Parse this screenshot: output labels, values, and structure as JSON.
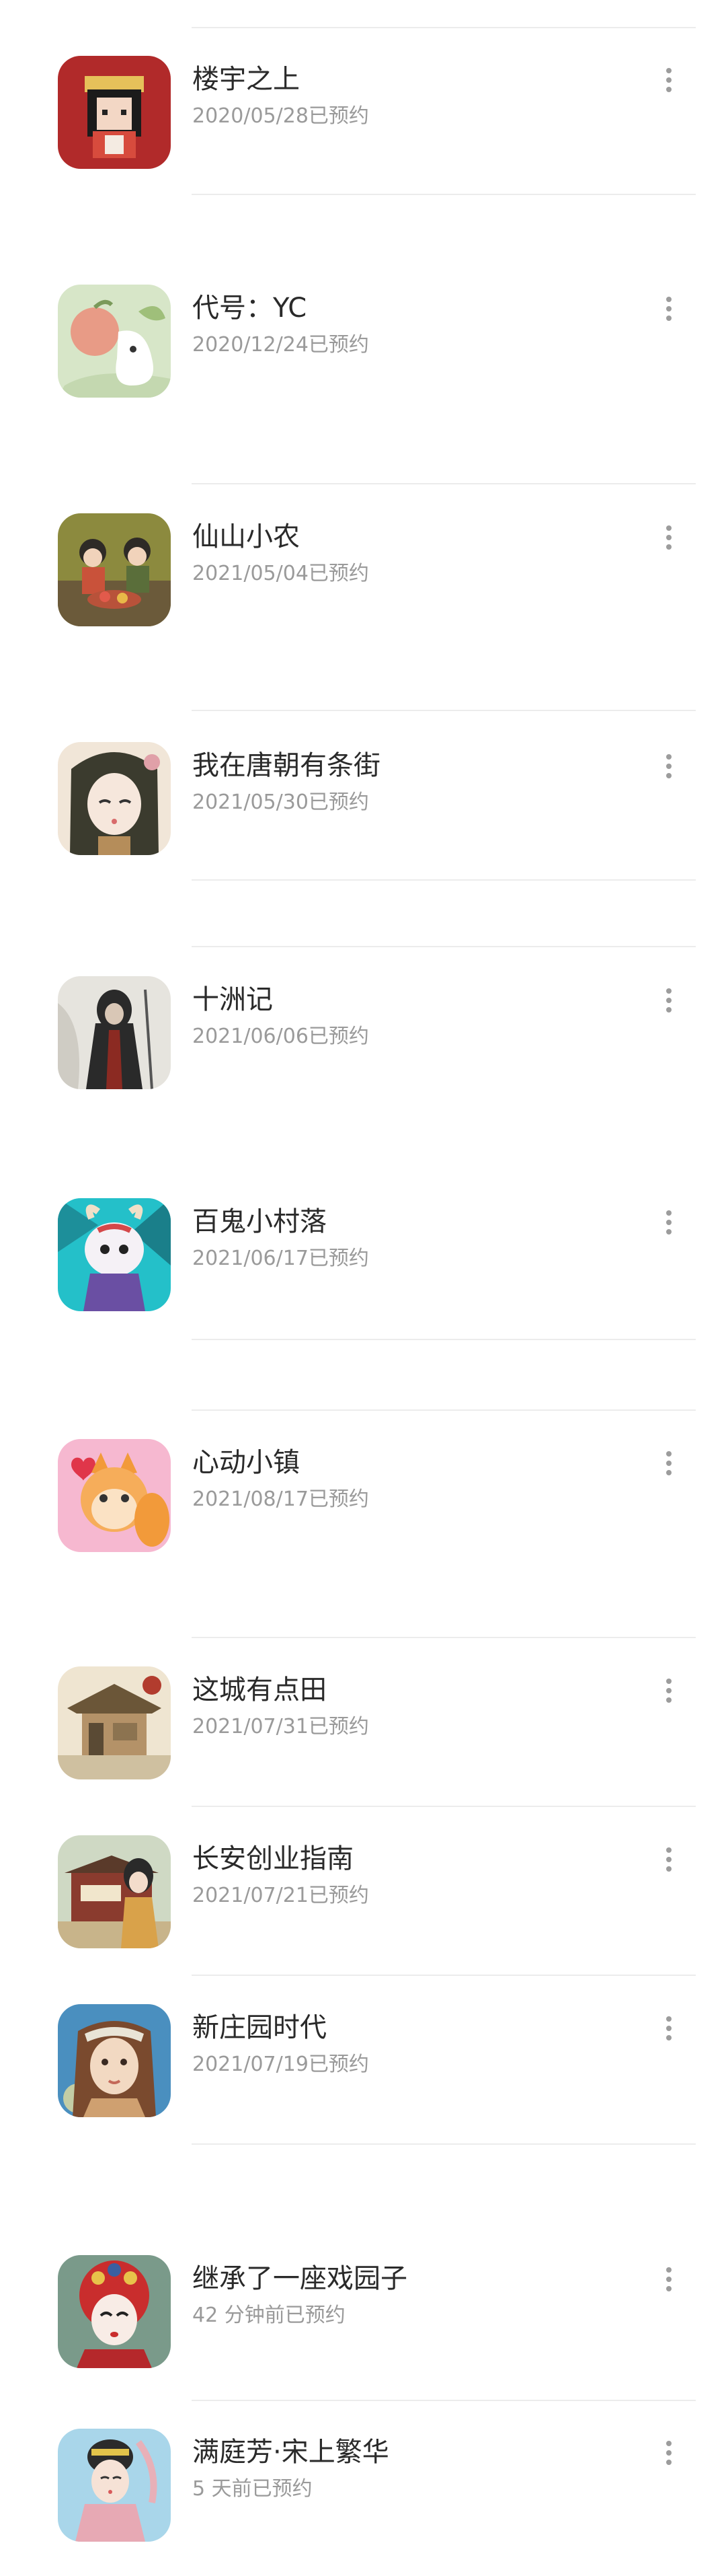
{
  "games": [
    {
      "title": "楼宇之上",
      "reserved": "2020/05/28已预约",
      "icon": "pixel-girl-game-icon",
      "colors": [
        "#b12a2a",
        "#f3d7c5"
      ]
    },
    {
      "title": "代号：YC",
      "reserved": "2020/12/24已预约",
      "icon": "peach-spirit-game-icon",
      "colors": [
        "#d7e6c8",
        "#e89b86"
      ]
    },
    {
      "title": "仙山小农",
      "reserved": "2021/05/04已预约",
      "icon": "farm-kids-game-icon",
      "colors": [
        "#8c8a3e",
        "#b8523a"
      ]
    },
    {
      "title": "我在唐朝有条街",
      "reserved": "2021/05/30已预约",
      "icon": "tang-girl-game-icon",
      "colors": [
        "#3b3b2e",
        "#f1e6d8"
      ]
    },
    {
      "title": "十洲记",
      "reserved": "2021/06/06已预约",
      "icon": "ink-warrior-game-icon",
      "colors": [
        "#e6e4de",
        "#2a2a2a"
      ]
    },
    {
      "title": "百鬼小村落",
      "reserved": "2021/06/17已预约",
      "icon": "ghost-creature-game-icon",
      "colors": [
        "#24c0c9",
        "#f5f1f6"
      ]
    },
    {
      "title": "心动小镇",
      "reserved": "2021/08/17已预约",
      "icon": "fox-heart-game-icon",
      "colors": [
        "#f6b8d0",
        "#f29a3a"
      ]
    },
    {
      "title": "这城有点田",
      "reserved": "2021/07/31已预约",
      "icon": "old-house-game-icon",
      "colors": [
        "#efe5d1",
        "#6b5638"
      ]
    },
    {
      "title": "长安创业指南",
      "reserved": "2021/07/21已预约",
      "icon": "changan-shop-game-icon",
      "colors": [
        "#cfd9c4",
        "#8a3b2e"
      ]
    },
    {
      "title": "新庄园时代",
      "reserved": "2021/07/19已预约",
      "icon": "farm-woman-game-icon",
      "colors": [
        "#4a8fbf",
        "#f2d9c2"
      ]
    },
    {
      "title": "继承了一座戏园子",
      "reserved": "42 分钟前已预约",
      "icon": "opera-mask-game-icon",
      "colors": [
        "#7a9a8a",
        "#c92d2d"
      ]
    },
    {
      "title": "满庭芳·宋上繁华",
      "reserved": "5 天前已预约",
      "icon": "song-lady-game-icon",
      "colors": [
        "#a9d6ea",
        "#2b2b2b"
      ]
    }
  ]
}
